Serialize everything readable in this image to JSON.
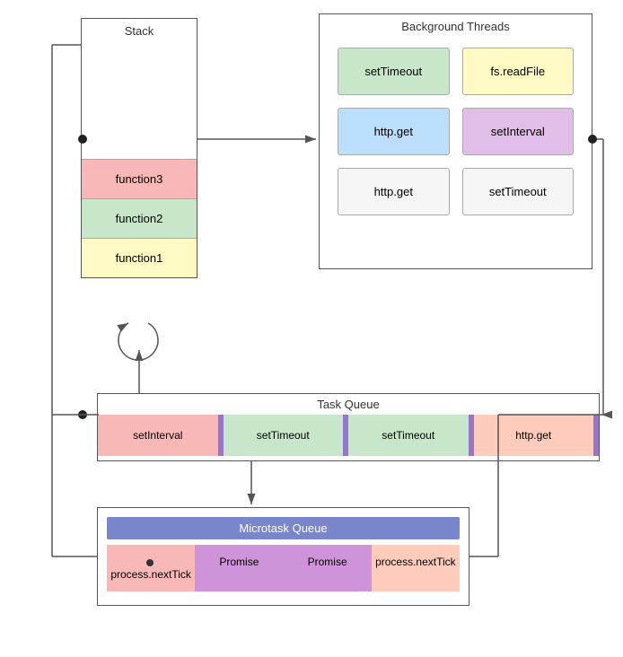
{
  "stack": {
    "title": "Stack",
    "items": [
      {
        "label": "function3",
        "color": "pink"
      },
      {
        "label": "function2",
        "color": "green"
      },
      {
        "label": "function1",
        "color": "yellow"
      }
    ]
  },
  "background_threads": {
    "title": "Background Threads",
    "items": [
      {
        "label": "setTimeout",
        "color": "bg-green"
      },
      {
        "label": "fs.readFile",
        "color": "bg-yellow"
      },
      {
        "label": "http.get",
        "color": "bg-blue"
      },
      {
        "label": "setInterval",
        "color": "bg-purple"
      },
      {
        "label": "http.get",
        "color": "bg-gray"
      },
      {
        "label": "setTimeout",
        "color": "bg-gray2"
      }
    ]
  },
  "task_queue": {
    "title": "Task Queue",
    "items": [
      {
        "label": "setInterval",
        "color": "task-pink"
      },
      {
        "label": "setTimeout",
        "color": "task-green"
      },
      {
        "label": "setTimeout",
        "color": "task-green2"
      },
      {
        "label": "http.get",
        "color": "task-peach"
      }
    ]
  },
  "microtask_queue": {
    "title": "Microtask Queue",
    "items": [
      {
        "label": "process.nextTick",
        "color": "micro-pink",
        "dot": true
      },
      {
        "label": "Promise",
        "color": "micro-purple"
      },
      {
        "label": "Promise",
        "color": "micro-purple2"
      },
      {
        "label": "process.nextTick",
        "color": "micro-peach"
      }
    ]
  }
}
